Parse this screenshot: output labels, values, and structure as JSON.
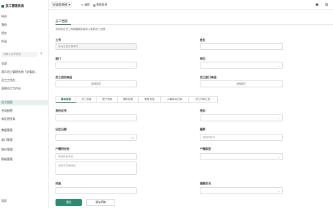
{
  "app": {
    "title": "员工管理系统"
  },
  "sidebar": {
    "items": [
      {
        "label": "待办"
      },
      {
        "label": "我的"
      },
      {
        "label": "经办"
      },
      {
        "label": "抄送"
      }
    ],
    "search_placeholder": "请输入名称搜索",
    "section_items": [
      {
        "label": "全部"
      },
      {
        "label": "演示员工管理系统「必看说..."
      },
      {
        "label": "员工工作台"
      },
      {
        "label": "离职员工工作台"
      },
      {
        "label": "员工档案"
      },
      {
        "label": "合同配置"
      },
      {
        "label": "单证明开具"
      },
      {
        "label": "数据管理"
      },
      {
        "label": "部门管理"
      },
      {
        "label": "职位管理"
      },
      {
        "label": "职级管理"
      }
    ],
    "footer": "管理"
  },
  "topbar": {
    "form_selector": "仅该组新建",
    "edit_label": "编辑",
    "manage_label": "数据管理"
  },
  "form": {
    "title": "员工档案",
    "desc": "支持导出员工档案模板批量导入数据员工信息",
    "fields": {
      "employee_no": {
        "label": "工号",
        "placeholder": "自动生成无需填写"
      },
      "name": {
        "label": "姓名"
      },
      "dept": {
        "label": "部门"
      },
      "position": {
        "label": "岗位"
      },
      "member_select": {
        "label": "员工成员单选",
        "button": "选择成员"
      },
      "dept_select": {
        "label": "员工部门单选",
        "button": "选择部门"
      }
    },
    "tabs": [
      "基本信息",
      "员工信息",
      "账户信息",
      "通讯信息",
      "教育信息",
      "人事异动记录",
      "员工材料汇总"
    ],
    "tab_fields": {
      "id_no": {
        "label": "身份证号"
      },
      "gender": {
        "label": "性别"
      },
      "birthday": {
        "label": "出生日期"
      },
      "origin": {
        "label": "籍贯",
        "placeholder": "请选择省市"
      },
      "hukou": {
        "label": "户籍所在地",
        "placeholder": "请选择省市区",
        "detail_placeholder": "请填写详细地址"
      },
      "hukou_type": {
        "label": "户籍类型"
      },
      "ethnic": {
        "label": "民族"
      },
      "marital": {
        "label": "婚姻状况"
      }
    }
  },
  "footer": {
    "submit": "提交",
    "save_draft": "保存草稿"
  },
  "colors": {
    "accent": "#2b6a5b",
    "primary_button": "#2e8a6e",
    "active_bg": "#e6f0ee"
  }
}
